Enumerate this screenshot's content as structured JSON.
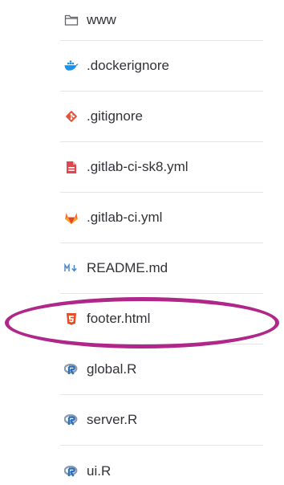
{
  "files": [
    {
      "name": "www",
      "icon": "folder-icon"
    },
    {
      "name": ".dockerignore",
      "icon": "docker-icon",
      "color": "#1d91e6"
    },
    {
      "name": ".gitignore",
      "icon": "git-icon",
      "color": "#e2553d"
    },
    {
      "name": ".gitlab-ci-sk8.yml",
      "icon": "yaml-file-icon",
      "color": "#e2454d"
    },
    {
      "name": ".gitlab-ci.yml",
      "icon": "gitlab-icon",
      "color": "#e24329"
    },
    {
      "name": "README.md",
      "icon": "markdown-icon",
      "color": "#4a88c8"
    },
    {
      "name": "footer.html",
      "icon": "html5-icon",
      "color": "#e44d26"
    },
    {
      "name": "global.R",
      "icon": "r-lang-icon",
      "color": "#2f6fb6"
    },
    {
      "name": "server.R",
      "icon": "r-lang-icon",
      "color": "#2f6fb6"
    },
    {
      "name": "ui.R",
      "icon": "r-lang-icon",
      "color": "#2f6fb6"
    }
  ],
  "highlight": {
    "target": "footer.html",
    "color": "#b0278a"
  }
}
